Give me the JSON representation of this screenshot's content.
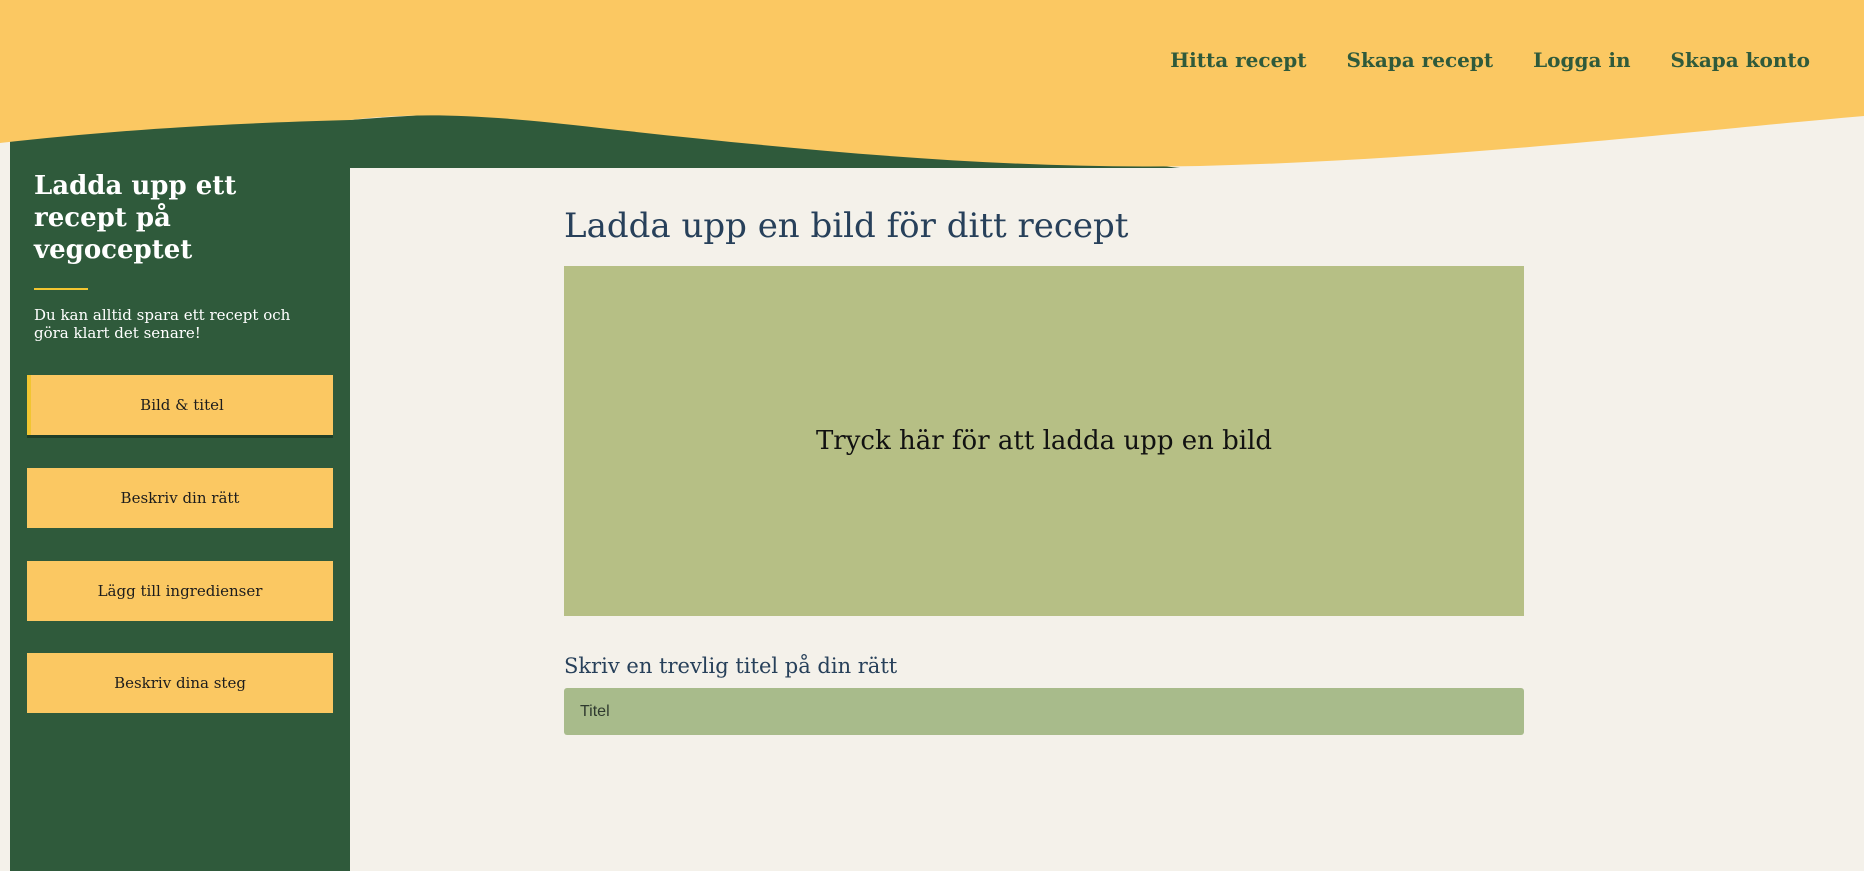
{
  "nav": {
    "items": [
      {
        "label": "Hitta recept"
      },
      {
        "label": "Skapa recept"
      },
      {
        "label": "Logga in"
      },
      {
        "label": "Skapa konto"
      }
    ]
  },
  "sidebar": {
    "title": "Ladda upp ett recept på vegoceptet",
    "description": "Du kan alltid spara ett recept och göra klart det senare!",
    "steps": [
      {
        "label": "Bild & titel",
        "active": true
      },
      {
        "label": "Beskriv din rätt",
        "active": false
      },
      {
        "label": "Lägg till ingredienser",
        "active": false
      },
      {
        "label": "Beskriv dina steg",
        "active": false
      }
    ]
  },
  "main": {
    "heading": "Ladda upp en bild för ditt recept",
    "upload_text": "Tryck här för att ladda upp en bild",
    "title_label": "Skriv en trevlig titel på din rätt",
    "title_placeholder": "Titel"
  },
  "colors": {
    "header": "#fbc862",
    "sidebar": "#2f5a3b",
    "background": "#f4f1ea",
    "upload_area": "#b6bf85",
    "input": "#a8bb8b",
    "heading_text": "#27405a"
  }
}
